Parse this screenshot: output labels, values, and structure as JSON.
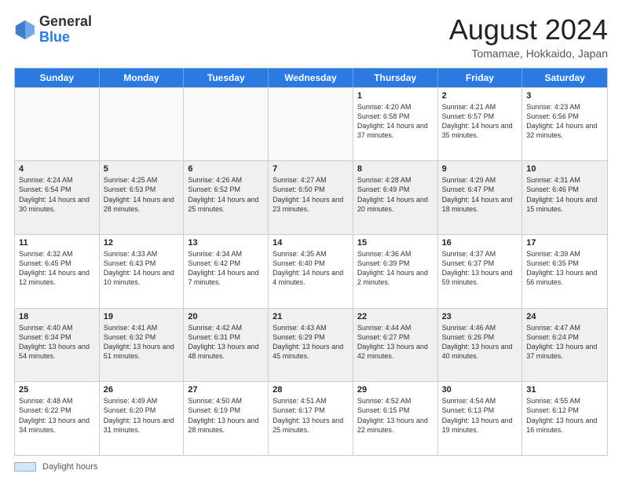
{
  "header": {
    "logo_general": "General",
    "logo_blue": "Blue",
    "month_year": "August 2024",
    "location": "Tomamae, Hokkaido, Japan"
  },
  "calendar": {
    "days_of_week": [
      "Sunday",
      "Monday",
      "Tuesday",
      "Wednesday",
      "Thursday",
      "Friday",
      "Saturday"
    ],
    "rows": [
      [
        {
          "day": "",
          "text": "",
          "empty": true
        },
        {
          "day": "",
          "text": "",
          "empty": true
        },
        {
          "day": "",
          "text": "",
          "empty": true
        },
        {
          "day": "",
          "text": "",
          "empty": true
        },
        {
          "day": "1",
          "text": "Sunrise: 4:20 AM\nSunset: 6:58 PM\nDaylight: 14 hours and 37 minutes.",
          "empty": false
        },
        {
          "day": "2",
          "text": "Sunrise: 4:21 AM\nSunset: 6:57 PM\nDaylight: 14 hours and 35 minutes.",
          "empty": false
        },
        {
          "day": "3",
          "text": "Sunrise: 4:23 AM\nSunset: 6:56 PM\nDaylight: 14 hours and 32 minutes.",
          "empty": false
        }
      ],
      [
        {
          "day": "4",
          "text": "Sunrise: 4:24 AM\nSunset: 6:54 PM\nDaylight: 14 hours and 30 minutes.",
          "empty": false
        },
        {
          "day": "5",
          "text": "Sunrise: 4:25 AM\nSunset: 6:53 PM\nDaylight: 14 hours and 28 minutes.",
          "empty": false
        },
        {
          "day": "6",
          "text": "Sunrise: 4:26 AM\nSunset: 6:52 PM\nDaylight: 14 hours and 25 minutes.",
          "empty": false
        },
        {
          "day": "7",
          "text": "Sunrise: 4:27 AM\nSunset: 6:50 PM\nDaylight: 14 hours and 23 minutes.",
          "empty": false
        },
        {
          "day": "8",
          "text": "Sunrise: 4:28 AM\nSunset: 6:49 PM\nDaylight: 14 hours and 20 minutes.",
          "empty": false
        },
        {
          "day": "9",
          "text": "Sunrise: 4:29 AM\nSunset: 6:47 PM\nDaylight: 14 hours and 18 minutes.",
          "empty": false
        },
        {
          "day": "10",
          "text": "Sunrise: 4:31 AM\nSunset: 6:46 PM\nDaylight: 14 hours and 15 minutes.",
          "empty": false
        }
      ],
      [
        {
          "day": "11",
          "text": "Sunrise: 4:32 AM\nSunset: 6:45 PM\nDaylight: 14 hours and 12 minutes.",
          "empty": false
        },
        {
          "day": "12",
          "text": "Sunrise: 4:33 AM\nSunset: 6:43 PM\nDaylight: 14 hours and 10 minutes.",
          "empty": false
        },
        {
          "day": "13",
          "text": "Sunrise: 4:34 AM\nSunset: 6:42 PM\nDaylight: 14 hours and 7 minutes.",
          "empty": false
        },
        {
          "day": "14",
          "text": "Sunrise: 4:35 AM\nSunset: 6:40 PM\nDaylight: 14 hours and 4 minutes.",
          "empty": false
        },
        {
          "day": "15",
          "text": "Sunrise: 4:36 AM\nSunset: 6:39 PM\nDaylight: 14 hours and 2 minutes.",
          "empty": false
        },
        {
          "day": "16",
          "text": "Sunrise: 4:37 AM\nSunset: 6:37 PM\nDaylight: 13 hours and 59 minutes.",
          "empty": false
        },
        {
          "day": "17",
          "text": "Sunrise: 4:39 AM\nSunset: 6:35 PM\nDaylight: 13 hours and 56 minutes.",
          "empty": false
        }
      ],
      [
        {
          "day": "18",
          "text": "Sunrise: 4:40 AM\nSunset: 6:34 PM\nDaylight: 13 hours and 54 minutes.",
          "empty": false
        },
        {
          "day": "19",
          "text": "Sunrise: 4:41 AM\nSunset: 6:32 PM\nDaylight: 13 hours and 51 minutes.",
          "empty": false
        },
        {
          "day": "20",
          "text": "Sunrise: 4:42 AM\nSunset: 6:31 PM\nDaylight: 13 hours and 48 minutes.",
          "empty": false
        },
        {
          "day": "21",
          "text": "Sunrise: 4:43 AM\nSunset: 6:29 PM\nDaylight: 13 hours and 45 minutes.",
          "empty": false
        },
        {
          "day": "22",
          "text": "Sunrise: 4:44 AM\nSunset: 6:27 PM\nDaylight: 13 hours and 42 minutes.",
          "empty": false
        },
        {
          "day": "23",
          "text": "Sunrise: 4:46 AM\nSunset: 6:26 PM\nDaylight: 13 hours and 40 minutes.",
          "empty": false
        },
        {
          "day": "24",
          "text": "Sunrise: 4:47 AM\nSunset: 6:24 PM\nDaylight: 13 hours and 37 minutes.",
          "empty": false
        }
      ],
      [
        {
          "day": "25",
          "text": "Sunrise: 4:48 AM\nSunset: 6:22 PM\nDaylight: 13 hours and 34 minutes.",
          "empty": false
        },
        {
          "day": "26",
          "text": "Sunrise: 4:49 AM\nSunset: 6:20 PM\nDaylight: 13 hours and 31 minutes.",
          "empty": false
        },
        {
          "day": "27",
          "text": "Sunrise: 4:50 AM\nSunset: 6:19 PM\nDaylight: 13 hours and 28 minutes.",
          "empty": false
        },
        {
          "day": "28",
          "text": "Sunrise: 4:51 AM\nSunset: 6:17 PM\nDaylight: 13 hours and 25 minutes.",
          "empty": false
        },
        {
          "day": "29",
          "text": "Sunrise: 4:52 AM\nSunset: 6:15 PM\nDaylight: 13 hours and 22 minutes.",
          "empty": false
        },
        {
          "day": "30",
          "text": "Sunrise: 4:54 AM\nSunset: 6:13 PM\nDaylight: 13 hours and 19 minutes.",
          "empty": false
        },
        {
          "day": "31",
          "text": "Sunrise: 4:55 AM\nSunset: 6:12 PM\nDaylight: 13 hours and 16 minutes.",
          "empty": false
        }
      ]
    ]
  },
  "footer": {
    "daylight_label": "Daylight hours"
  }
}
